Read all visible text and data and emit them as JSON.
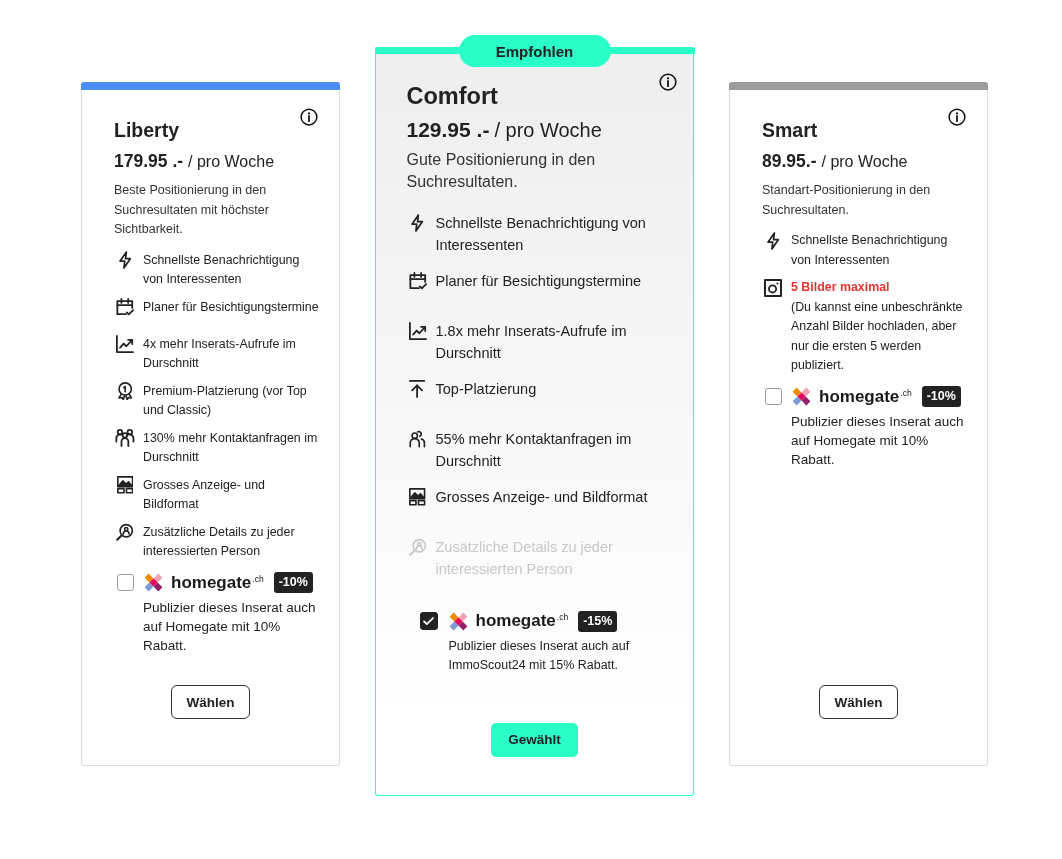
{
  "plans": [
    {
      "name": "Liberty",
      "price": "179.95 .-",
      "period": "/ pro Woche",
      "color": "#4b8ef4",
      "selected": false,
      "description": "Beste Positionierung in den Suchresultaten mit höchster Sichtbarkeit.",
      "features": [
        {
          "kind": "notification",
          "text": "Schnellste Benachrichtigung von Interessenten",
          "disabled": false
        },
        {
          "kind": "scheduler",
          "text": "Planer für Besichtigungstermine",
          "disabled": false
        },
        {
          "kind": "views",
          "text": "4x mehr Inserats-Aufrufe im Durschnitt",
          "disabled": false
        },
        {
          "kind": "premium",
          "text": "Premium-Platzierung (vor Top und Classic)",
          "disabled": false
        },
        {
          "kind": "group",
          "text": "130% mehr Kontaktanfragen im Durschnitt",
          "disabled": false
        },
        {
          "kind": "format",
          "text": "Grosses Anzeige- und Bildformat",
          "disabled": false
        },
        {
          "kind": "details",
          "text": "Zusätzliche Details zu jeder interessierten Person",
          "disabled": false
        }
      ],
      "addon": {
        "checked": false,
        "brand": "homegate$^{.ch}$",
        "discount": "-10%",
        "text": "Publizier dieses Inserat auch auf Homegate mit 10% Rabatt."
      },
      "button": "Wählen"
    },
    {
      "name": "Comfort",
      "badge": "Empfohlen",
      "price": "129.95 .-",
      "period": "/ pro Woche",
      "color": "#2bffc8",
      "selected": true,
      "description": "Gute Positionierung in den Suchresultaten.",
      "features": [
        {
          "kind": "notification",
          "text": "Schnellste Benachrichtigung von Interessenten",
          "disabled": false
        },
        {
          "kind": "scheduler",
          "text": "Planer für Besichtigungstermine",
          "disabled": false
        },
        {
          "kind": "views",
          "text": "1.8x mehr Inserats-Aufrufe im Durschnitt",
          "disabled": false
        },
        {
          "kind": "top",
          "text": "Top-Platzierung",
          "disabled": false
        },
        {
          "kind": "person",
          "text": "55% mehr Kontaktanfragen im Durschnitt",
          "disabled": false
        },
        {
          "kind": "format",
          "text": "Grosses Anzeige- und Bildformat",
          "disabled": false
        },
        {
          "kind": "details",
          "text": "Zusätzliche Details zu jeder interessierten Person",
          "disabled": true
        }
      ],
      "addon": {
        "checked": true,
        "brand": "homegate$^{.ch}$",
        "discount": "-15%",
        "text": "Publizier dieses Inserat auch auf ImmoScout24 mit 15% Rabatt."
      },
      "button": "Gewählt"
    },
    {
      "name": "Smart",
      "price": "89.95.-",
      "period": "/ pro Woche",
      "color": "#9b9b9b",
      "selected": false,
      "description": "Standart-Positionierung in den Suchresultaten.",
      "features": [
        {
          "kind": "notification",
          "text": "Schnellste Benachrichtigung von Interessenten",
          "disabled": false
        },
        {
          "kind": "photos",
          "alert": "5 Bilder maximal",
          "text": "(Du kannst eine unbeschränkte Anzahl Bilder hochladen, aber nur die ersten 5 werden publiziert.",
          "disabled": false
        }
      ],
      "addon": {
        "checked": false,
        "brand": "homegate$^{.ch}$",
        "discount": "-10%",
        "text": "Publizier dieses Inserat auch auf Homegate mit 10% Rabatt."
      },
      "button": "Wählen"
    }
  ]
}
